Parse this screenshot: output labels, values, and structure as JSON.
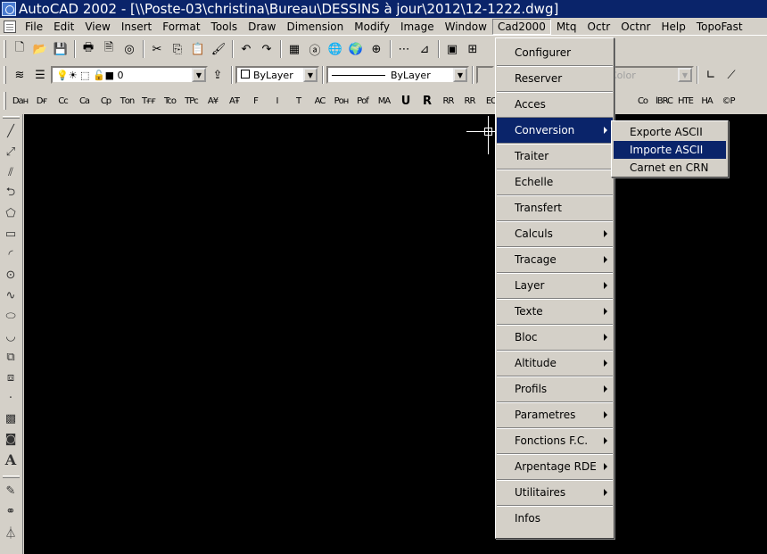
{
  "window": {
    "title": "AutoCAD 2002 - [\\\\Poste-03\\christina\\Bureau\\DESSINS à jour\\2012\\12-1222.dwg]"
  },
  "menubar": {
    "items": [
      "File",
      "Edit",
      "View",
      "Insert",
      "Format",
      "Tools",
      "Draw",
      "Dimension",
      "Modify",
      "Image",
      "Window",
      "Cad2000",
      "Mtq",
      "Octr",
      "Octnr",
      "Help",
      "TopoFast"
    ],
    "active": "Cad2000"
  },
  "toolbar_layers": {
    "layer_value": "0",
    "color_value": "ByLayer",
    "linetype_value": "ByLayer",
    "plot_color": "Color"
  },
  "toolbar_custom": {
    "buttons": [
      "Dан",
      "Dғ",
      "Cc",
      "Cа",
      "Cр",
      "Tоn",
      "Tғғ",
      "Tco",
      "TPc",
      "A¥",
      "AŦ",
      "F",
      "I",
      "T",
      "AC",
      "Pон",
      "Pоf",
      "MA",
      "U",
      "R",
      "RR",
      "RR",
      "EC"
    ]
  },
  "toolbar_right": {
    "buttons": [
      "Co",
      "lBRC",
      "HTE",
      "HA",
      "©P"
    ]
  },
  "cad2000_menu": {
    "items": [
      {
        "label": "Configurer",
        "submenu": false
      },
      {
        "label": "Reserver",
        "submenu": false
      },
      {
        "label": "Acces",
        "submenu": false
      },
      {
        "label": "Conversion",
        "submenu": true,
        "selected": true
      },
      {
        "label": "Traiter",
        "submenu": false
      },
      {
        "label": "Echelle",
        "submenu": false
      },
      {
        "label": "Transfert",
        "submenu": false
      },
      {
        "label": "Calculs",
        "submenu": true
      },
      {
        "label": "Tracage",
        "submenu": true
      },
      {
        "label": "Layer",
        "submenu": true
      },
      {
        "label": "Texte",
        "submenu": true
      },
      {
        "label": "Bloc",
        "submenu": true
      },
      {
        "label": "Altitude",
        "submenu": true
      },
      {
        "label": "Profils",
        "submenu": true
      },
      {
        "label": "Parametres",
        "submenu": true
      },
      {
        "label": "Fonctions F.C.",
        "submenu": true
      },
      {
        "label": "Arpentage RDE",
        "submenu": true
      },
      {
        "label": "Utilitaires",
        "submenu": true
      },
      {
        "label": "Infos",
        "submenu": false
      }
    ]
  },
  "conversion_submenu": {
    "items": [
      "Exporte ASCII",
      "Importe ASCII",
      "Carnet en CRN"
    ],
    "selected": "Importe ASCII"
  },
  "colors": {
    "titlebar": "#0a246a",
    "highlight": "#0a246a",
    "canvas": "#000000",
    "chrome": "#d4d0c8"
  }
}
